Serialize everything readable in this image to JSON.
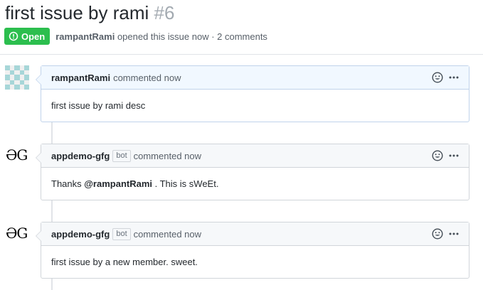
{
  "issue": {
    "title": "first issue by rami",
    "number": "#6",
    "state": "Open",
    "author": "rampantRami",
    "summary": "opened this issue now · 2 comments"
  },
  "colors": {
    "open_badge": "#2cbe4e",
    "gfg_green": "#2f8d46"
  },
  "comments": [
    {
      "author": "rampantRami",
      "is_bot": false,
      "time": "commented now",
      "avatar": "identicon-avatar",
      "body": "first issue by rami desc"
    },
    {
      "author": "appdemo-gfg",
      "is_bot": true,
      "bot_label": "bot",
      "time": "commented now",
      "avatar": "geeksforgeeks-logo",
      "body_prefix": "Thanks ",
      "mention": "@rampantRami",
      "body_suffix": " . This is sWeEt."
    },
    {
      "author": "appdemo-gfg",
      "is_bot": true,
      "bot_label": "bot",
      "time": "commented now",
      "avatar": "geeksforgeeks-logo",
      "body": "first issue by a new member. sweet."
    }
  ]
}
